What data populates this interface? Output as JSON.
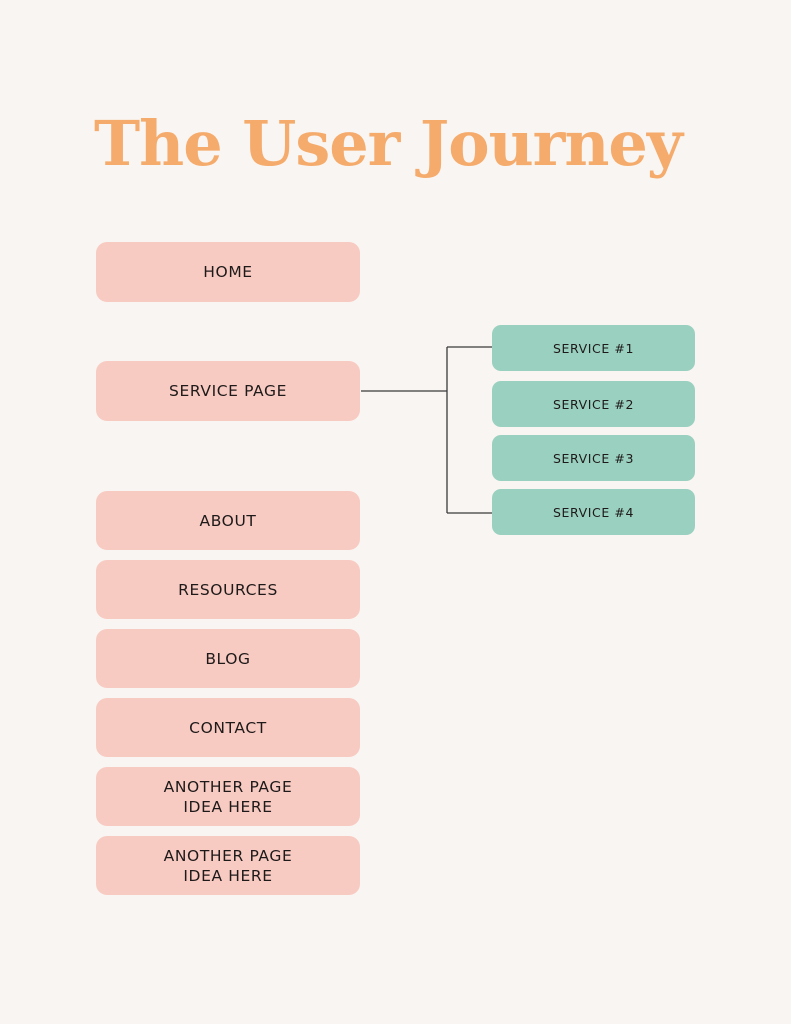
{
  "title": "The User Journey",
  "colors": {
    "background": "#f9f5f2",
    "title": "#f5ab6c",
    "page_box": "#f8cbc2",
    "service_box": "#9ad0bf",
    "text": "#1e1a1a",
    "connector": "#3a3a3a"
  },
  "pages": [
    {
      "label": "HOME"
    },
    {
      "label": "SERVICE PAGE"
    },
    {
      "label": "ABOUT"
    },
    {
      "label": "RESOURCES"
    },
    {
      "label": "BLOG"
    },
    {
      "label": "CONTACT"
    },
    {
      "label": "ANOTHER PAGE\nIDEA HERE"
    },
    {
      "label": "ANOTHER PAGE\nIDEA HERE"
    }
  ],
  "services": {
    "parent": "SERVICE PAGE",
    "items": [
      {
        "label": "SERVICE #1"
      },
      {
        "label": "SERVICE #2"
      },
      {
        "label": "SERVICE #3"
      },
      {
        "label": "SERVICE #4"
      }
    ]
  }
}
